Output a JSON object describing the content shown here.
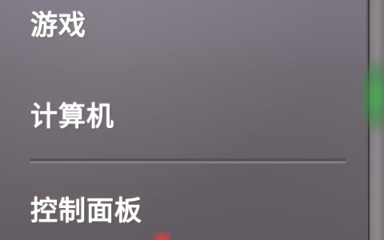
{
  "start_menu": {
    "items": [
      {
        "label": "游戏"
      },
      {
        "label": "计算机"
      },
      {
        "label": "控制面板"
      }
    ]
  },
  "colors": {
    "panel": "#736b74",
    "text": "#ffffff",
    "accent_green": "#46aa50",
    "accent_red": "#e63c3c"
  }
}
